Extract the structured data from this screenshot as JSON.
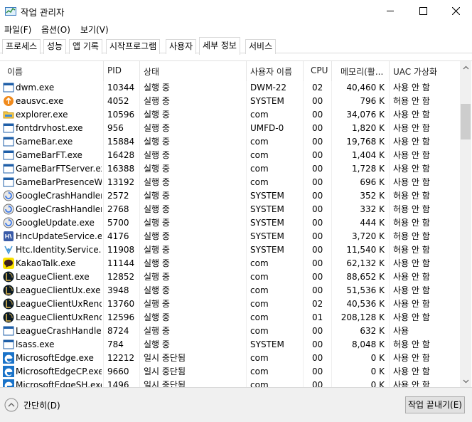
{
  "window": {
    "title": "작업 관리자",
    "app_icon": "task-manager-icon"
  },
  "menu": [
    "파일(F)",
    "옵션(O)",
    "보기(V)"
  ],
  "tabs": [
    {
      "label": "프로세스",
      "active": false
    },
    {
      "label": "성능",
      "active": false
    },
    {
      "label": "앱 기록",
      "active": false
    },
    {
      "label": "시작프로그램",
      "active": false
    },
    {
      "label": "사용자",
      "active": false
    },
    {
      "label": "세부 정보",
      "active": true
    },
    {
      "label": "서비스",
      "active": false
    }
  ],
  "columns": [
    "이름",
    "PID",
    "상태",
    "사용자 이름",
    "CPU",
    "메모리(활...",
    "UAC 가상화"
  ],
  "rows": [
    {
      "icon": "window-icon",
      "name": "dwm.exe",
      "pid": "10344",
      "status": "실행 중",
      "user": "DWM-22",
      "cpu": "02",
      "mem": "40,460 K",
      "uac": "사용 안 함"
    },
    {
      "icon": "orange-circle-icon",
      "name": "eausvc.exe",
      "pid": "4052",
      "status": "실행 중",
      "user": "SYSTEM",
      "cpu": "00",
      "mem": "796 K",
      "uac": "허용 안 함"
    },
    {
      "icon": "folder-icon",
      "name": "explorer.exe",
      "pid": "10596",
      "status": "실행 중",
      "user": "com",
      "cpu": "00",
      "mem": "34,076 K",
      "uac": "사용 안 함"
    },
    {
      "icon": "window-icon",
      "name": "fontdrvhost.exe",
      "pid": "956",
      "status": "실행 중",
      "user": "UMFD-0",
      "cpu": "00",
      "mem": "1,820 K",
      "uac": "사용 안 함"
    },
    {
      "icon": "window-icon",
      "name": "GameBar.exe",
      "pid": "15884",
      "status": "실행 중",
      "user": "com",
      "cpu": "00",
      "mem": "19,768 K",
      "uac": "사용 안 함"
    },
    {
      "icon": "window-icon",
      "name": "GameBarFT.exe",
      "pid": "16428",
      "status": "실행 중",
      "user": "com",
      "cpu": "00",
      "mem": "1,404 K",
      "uac": "사용 안 함"
    },
    {
      "icon": "window-icon",
      "name": "GameBarFTServer.exe",
      "pid": "16388",
      "status": "실행 중",
      "user": "com",
      "cpu": "00",
      "mem": "1,728 K",
      "uac": "사용 안 함"
    },
    {
      "icon": "window-icon",
      "name": "GameBarPresenceWr...",
      "pid": "13192",
      "status": "실행 중",
      "user": "com",
      "cpu": "00",
      "mem": "696 K",
      "uac": "사용 안 함"
    },
    {
      "icon": "google-update-icon",
      "name": "GoogleCrashHandler...",
      "pid": "2572",
      "status": "실행 중",
      "user": "SYSTEM",
      "cpu": "00",
      "mem": "352 K",
      "uac": "허용 안 함"
    },
    {
      "icon": "google-update-icon",
      "name": "GoogleCrashHandler...",
      "pid": "2768",
      "status": "실행 중",
      "user": "SYSTEM",
      "cpu": "00",
      "mem": "332 K",
      "uac": "허용 안 함"
    },
    {
      "icon": "google-update-icon",
      "name": "GoogleUpdate.exe",
      "pid": "5700",
      "status": "실행 중",
      "user": "SYSTEM",
      "cpu": "00",
      "mem": "444 K",
      "uac": "허용 안 함"
    },
    {
      "icon": "hnc-update-icon",
      "name": "HncUpdateService.exe",
      "pid": "4176",
      "status": "실행 중",
      "user": "SYSTEM",
      "cpu": "00",
      "mem": "3,720 K",
      "uac": "허용 안 함"
    },
    {
      "icon": "htc-identity-icon",
      "name": "Htc.Identity.Service....",
      "pid": "11908",
      "status": "실행 중",
      "user": "SYSTEM",
      "cpu": "00",
      "mem": "11,540 K",
      "uac": "허용 안 함"
    },
    {
      "icon": "kakaotalk-icon",
      "name": "KakaoTalk.exe",
      "pid": "11144",
      "status": "실행 중",
      "user": "com",
      "cpu": "00",
      "mem": "62,132 K",
      "uac": "사용 안 함"
    },
    {
      "icon": "league-icon",
      "name": "LeagueClient.exe",
      "pid": "12852",
      "status": "실행 중",
      "user": "com",
      "cpu": "00",
      "mem": "88,652 K",
      "uac": "사용 안 함"
    },
    {
      "icon": "league-icon",
      "name": "LeagueClientUx.exe",
      "pid": "3948",
      "status": "실행 중",
      "user": "com",
      "cpu": "00",
      "mem": "51,536 K",
      "uac": "사용 안 함"
    },
    {
      "icon": "league-icon",
      "name": "LeagueClientUxRend...",
      "pid": "13760",
      "status": "실행 중",
      "user": "com",
      "cpu": "02",
      "mem": "40,536 K",
      "uac": "사용 안 함"
    },
    {
      "icon": "league-icon",
      "name": "LeagueClientUxRend...",
      "pid": "12596",
      "status": "실행 중",
      "user": "com",
      "cpu": "01",
      "mem": "208,128 K",
      "uac": "사용 안 함"
    },
    {
      "icon": "window-icon",
      "name": "LeagueCrashHandler...",
      "pid": "8724",
      "status": "실행 중",
      "user": "com",
      "cpu": "00",
      "mem": "632 K",
      "uac": "사용"
    },
    {
      "icon": "window-icon",
      "name": "lsass.exe",
      "pid": "784",
      "status": "실행 중",
      "user": "SYSTEM",
      "cpu": "00",
      "mem": "8,048 K",
      "uac": "허용 안 함"
    },
    {
      "icon": "edge-icon",
      "name": "MicrosoftEdge.exe",
      "pid": "12212",
      "status": "일시 중단됨",
      "user": "com",
      "cpu": "00",
      "mem": "0 K",
      "uac": "사용 안 함"
    },
    {
      "icon": "edge-icon",
      "name": "MicrosoftEdgeCP.exe",
      "pid": "9660",
      "status": "일시 중단됨",
      "user": "com",
      "cpu": "00",
      "mem": "0 K",
      "uac": "사용 안 함"
    },
    {
      "icon": "edge-icon",
      "name": "MicrosoftEdgeSH.exe",
      "pid": "1496",
      "status": "일시 중단됨",
      "user": "com",
      "cpu": "00",
      "mem": "0 K",
      "uac": "사용 안 함"
    }
  ],
  "footer": {
    "fewer_details": "간단히(D)",
    "end_task": "작업 끝내기(E)"
  }
}
